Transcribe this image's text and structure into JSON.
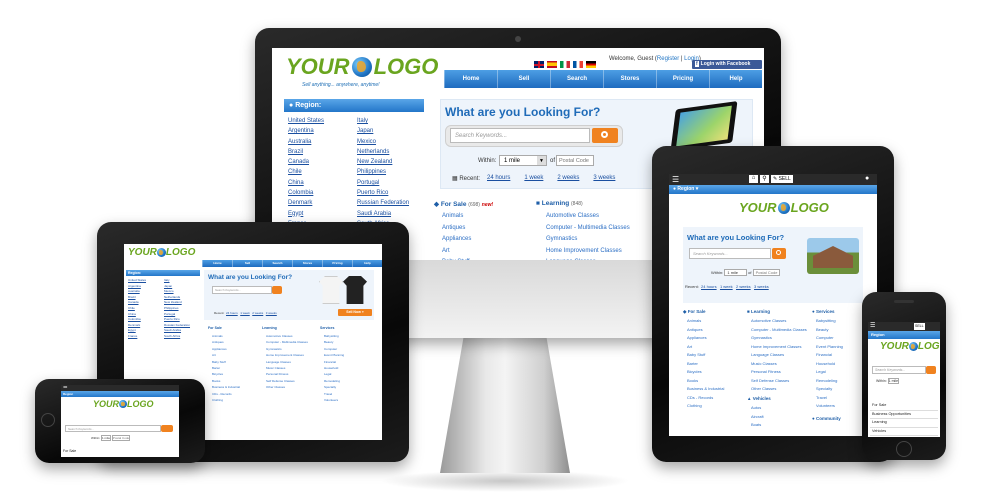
{
  "logo": {
    "your": "YOUR",
    "logo": "LOGO",
    "tagline": "Sell anything... anywhere, anytime!"
  },
  "header": {
    "welcome": "Welcome, Guest (",
    "register": "Register",
    "sep": " | ",
    "login": "Login",
    "close": ")",
    "facebook": "Login with Facebook"
  },
  "nav": [
    "Home",
    "Sell",
    "Search",
    "Stores",
    "Pricing",
    "Help"
  ],
  "region": {
    "title": "Region:",
    "col1": [
      "United States",
      "Argentina",
      "Australia",
      "Brazil",
      "Canada",
      "Chile",
      "China",
      "Colombia",
      "Denmark",
      "Egypt",
      "France"
    ],
    "col2": [
      "Italy",
      "Japan",
      "Mexico",
      "Netherlands",
      "New Zealand",
      "Philippines",
      "Portugal",
      "Puerto Rico",
      "Russian Federation",
      "Saudi Arabia",
      "South Africa"
    ]
  },
  "search": {
    "title": "What are you Looking For?",
    "placeholder": "Search Keywords...",
    "within_label": "Within:",
    "within_value": "1 mile",
    "of": "of",
    "postal": "Postal Code",
    "recent_label": "Recent:",
    "recent": [
      "24 hours",
      "1 week",
      "2 weeks",
      "3 weeks"
    ]
  },
  "categories": {
    "for_sale": {
      "title": "For Sale",
      "count": "(698)",
      "badge": "new!",
      "items": [
        "Animals",
        "Antiques",
        "Appliances",
        "Art",
        "Baby Stuff",
        "Barter",
        "Bicycles",
        "Books",
        "Business & Industrial",
        "CDs - Records",
        "Clothing"
      ]
    },
    "learning": {
      "title": "Learning",
      "count": "(848)",
      "items": [
        "Automotive Classes",
        "Computer - Multimedia Classes",
        "Gymnastics",
        "Home Improvement Classes",
        "Language Classes",
        "Music Classes",
        "Personal Fitness",
        "Self Defense Classes",
        "Other Classes"
      ]
    },
    "vehicles": {
      "title": "Vehicles",
      "count": "(1198)",
      "items": [
        "Autos"
      ]
    }
  },
  "tablet": {
    "nav": [
      "SELL"
    ],
    "region": "Region",
    "services": {
      "title": "Services",
      "items": [
        "Babysitting",
        "Beauty",
        "Computer",
        "Event Planning",
        "Financial",
        "Household",
        "Legal",
        "Remodeling",
        "Specialty",
        "Travel",
        "Volunteers"
      ]
    },
    "community": {
      "title": "Community"
    },
    "vehicles_items": [
      "Autos",
      "Aircraft",
      "Boats"
    ]
  },
  "phone": {
    "list": [
      "For Sale",
      "Business Opportunities",
      "Learning",
      "Vehicles"
    ]
  },
  "ipad_left": {
    "sell_now": "Sell Now »"
  },
  "colors": {
    "nav_blue": "#2a7ccc",
    "orange": "#f0821f",
    "logo_green": "#6aa51f",
    "link_blue": "#1a4fa0"
  }
}
